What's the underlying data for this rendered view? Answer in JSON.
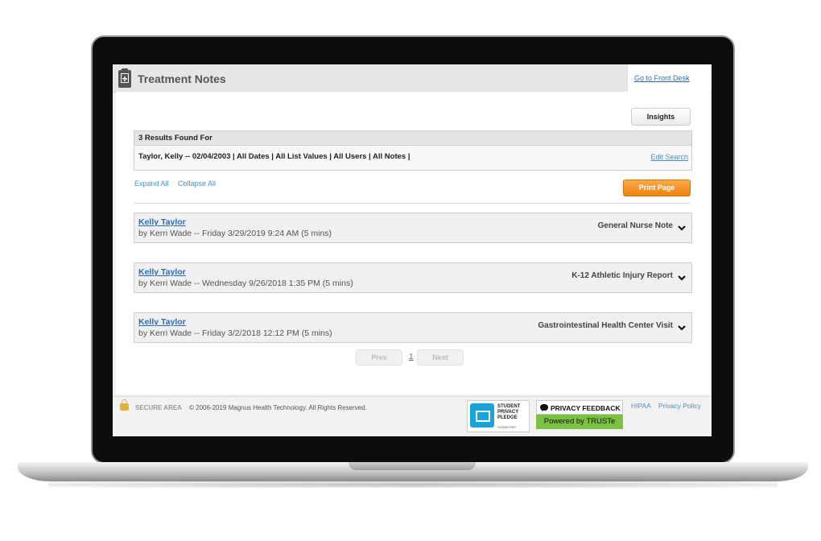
{
  "header": {
    "title": "Treatment Notes",
    "front_desk_link": "Go to Front Desk"
  },
  "toolbar": {
    "insights_label": "Insights",
    "print_label": "Print Page",
    "expand_all": "Expand All",
    "collapse_all": "Collapse All"
  },
  "results": {
    "title": "3 Results Found For",
    "criteria": "Taylor, Kelly -- 02/04/2003 | All Dates | All List Values | All Users | All Notes |",
    "edit_search": "Edit Search"
  },
  "notes": [
    {
      "name": "Kelly Taylor",
      "meta": "by Kerri Wade -- Friday 3/29/2019 9:24 AM (5 mins)",
      "type": "General Nurse Note"
    },
    {
      "name": "Kelly Taylor",
      "meta": "by Kerri Wade -- Wednesday 9/26/2018 1:35 PM (5 mins)",
      "type": "K-12 Athletic Injury Report"
    },
    {
      "name": "Kelly Taylor",
      "meta": "by Kerri Wade -- Friday 3/2/2018 12:12 PM (5 mins)",
      "type": "Gastrointestinal Health Center Visit"
    }
  ],
  "pager": {
    "prev": "Prev",
    "current": "1",
    "next": "Next"
  },
  "footer": {
    "secure_area": "SECURE AREA",
    "copyright": "© 2006-2019 Magnus Health Technology. All Rights Reserved.",
    "pledge_text": "STUDENT PRIVACY PLEDGE",
    "pledge_signatory": "SIGNATORY",
    "privacy_feedback": "PRIVACY FEEDBACK",
    "powered_by": "Powered by TRUSTe",
    "hipaa": "HIPAA",
    "privacy_policy": "Privacy Policy"
  },
  "colors": {
    "accent_link": "#2a6ebb",
    "print_button": "#ef8410",
    "truste_green": "#7cc242",
    "pledge_blue": "#1aa3d9"
  }
}
